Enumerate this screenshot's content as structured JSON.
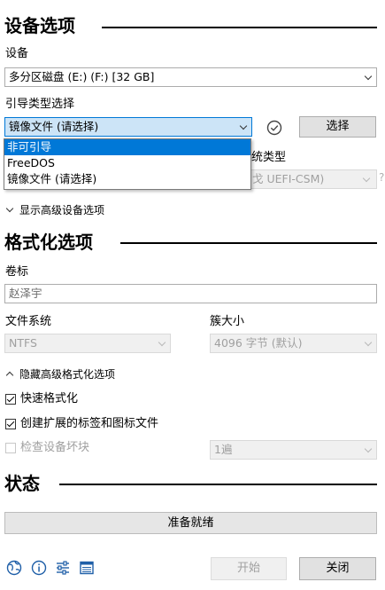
{
  "device_options": {
    "title": "设备选项",
    "device_label": "设备",
    "device_value": "多分区磁盘 (E:) (F:) [32 GB]",
    "boot_label": "引导类型选择",
    "boot_value": "镜像文件 (请选择)",
    "select_button": "选择",
    "boot_options": [
      "非可引导",
      "FreeDOS",
      "镜像文件 (请选择)"
    ],
    "partition_label_partial": "统类型",
    "partition_value_partial": "戈 UEFI-CSM)",
    "help_mark": "?",
    "advanced_toggle": "显示高级设备选项"
  },
  "format_options": {
    "title": "格式化选项",
    "volume_label": "卷标",
    "volume_value": "赵泽宇",
    "fs_label": "文件系统",
    "fs_value": "NTFS",
    "cluster_label": "簇大小",
    "cluster_value": "4096 字节 (默认)",
    "advanced_toggle": "隐藏高级格式化选项",
    "quick_format": {
      "label": "快速格式化",
      "checked": true
    },
    "extended_label": {
      "label": "创建扩展的标签和图标文件",
      "checked": true
    },
    "bad_blocks": {
      "label": "检查设备坏块",
      "checked": false
    },
    "passes_value": "1遍"
  },
  "status": {
    "title": "状态",
    "message": "准备就绪"
  },
  "footer": {
    "icons": [
      "globe-icon",
      "info-icon",
      "settings-icon",
      "log-icon"
    ],
    "start_button": "开始",
    "close_button": "关闭"
  },
  "colors": {
    "accent": "#0078d7",
    "highlight_field": "#cce4f7"
  }
}
